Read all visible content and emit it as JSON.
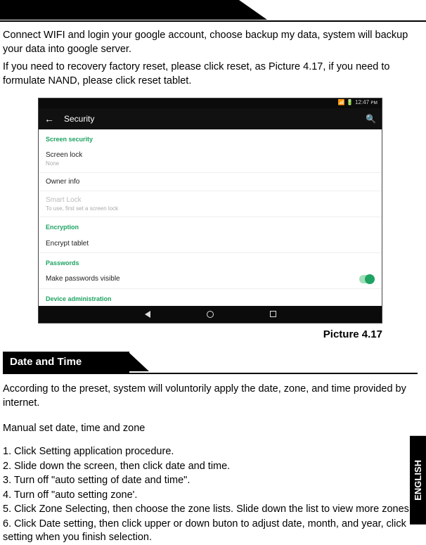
{
  "intro": {
    "p1": "Connect WIFI and login your google account, choose backup my data, system will backup your data into google server.",
    "p2": "If you need to recovery factory reset, please click reset, as Picture 4.17, if you need to formulate NAND, please click reset tablet."
  },
  "screenshot": {
    "status_right": "📶 🔋 12:47 ᴘᴍ",
    "back_arrow": "←",
    "title": "Security",
    "search_icon": "🔍",
    "sections": {
      "screen_security": "Screen security",
      "screen_lock": "Screen lock",
      "screen_lock_sub": "None",
      "owner_info": "Owner info",
      "smart_lock": "Smart Lock",
      "smart_lock_sub": "To use, first set a screen lock",
      "encryption": "Encryption",
      "encrypt_tablet": "Encrypt tablet",
      "passwords": "Passwords",
      "make_pw_visible": "Make passwords visible",
      "device_admin": "Device administration"
    }
  },
  "caption": "Picture 4.17",
  "date_time": {
    "heading": "Date and Time",
    "intro": "According to the preset, system will voluntorily apply the date, zone, and time provided by internet.",
    "manual_head": "Manual set date, time and zone",
    "steps": {
      "s1": "1. Click Setting application procedure.",
      "s2": "2. Slide down the screen, then click date and time.",
      "s3": "3. Turn off \"auto setting of date and time\".",
      "s4": "4. Turn off \"auto setting zone'.",
      "s5": "5. Click Zone Selecting, then choose the zone lists. Slide down the list to view more zones.",
      "s6": "6. Click Date setting, then click upper or down buton to adjust date, month, and year, click setting when you finish selection."
    }
  },
  "side_tab": "ENGLISH"
}
